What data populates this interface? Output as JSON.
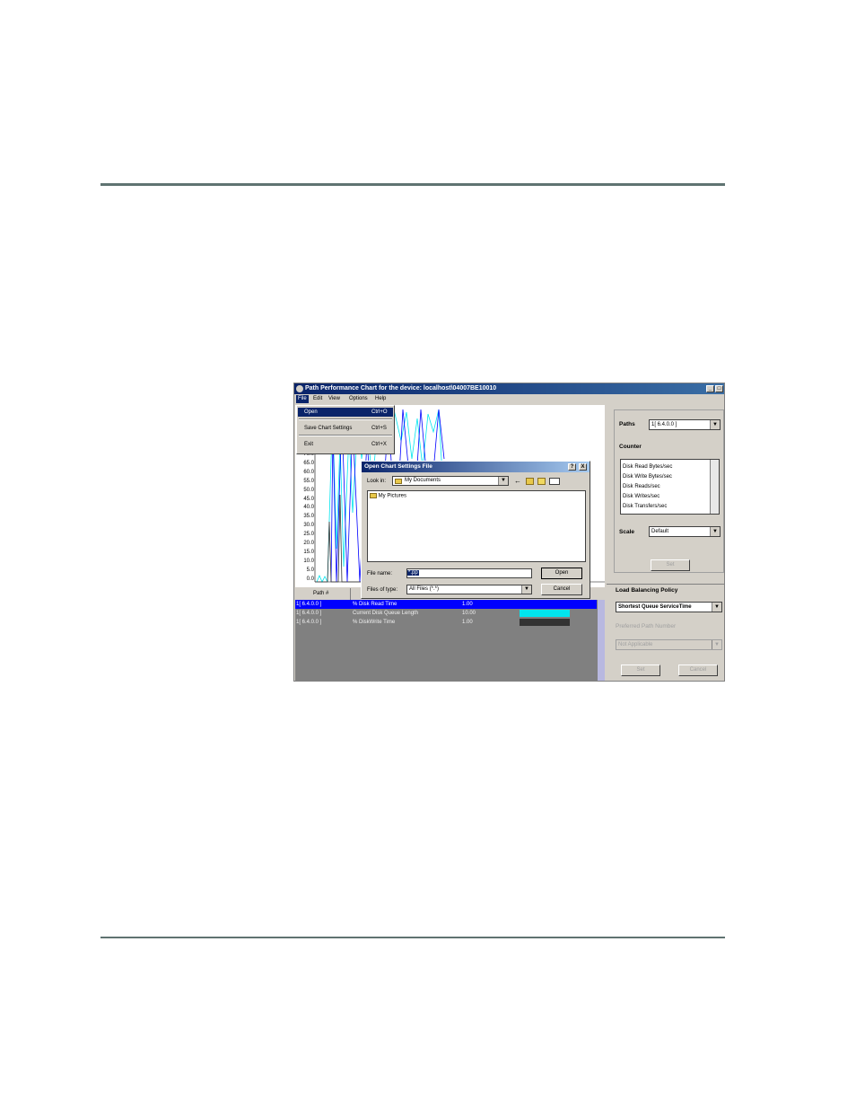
{
  "window": {
    "title": "Path Performance Chart for the device: localhost\\04007BE10010",
    "controls": [
      "_",
      "□"
    ],
    "menu": [
      "File",
      "Edit",
      "View",
      "Options",
      "Help"
    ]
  },
  "file_menu": {
    "items": [
      {
        "label": "Open",
        "shortcut": "Ctrl+O",
        "selected": true
      },
      {
        "label": "Save Chart Settings",
        "shortcut": "Ctrl+S",
        "selected": false
      },
      {
        "label": "Exit",
        "shortcut": "Ctrl+X",
        "selected": false
      }
    ]
  },
  "chart": {
    "y_ticks": [
      "70.0",
      "65.0",
      "60.0",
      "55.0",
      "50.0",
      "45.0",
      "40.0",
      "35.0",
      "30.0",
      "25.0",
      "20.0",
      "15.0",
      "10.0",
      "5.0",
      "0.0"
    ],
    "colors": {
      "series1": "#0000ff",
      "series2": "#00e5ee",
      "series3": "#333333"
    }
  },
  "right_panel": {
    "paths_label": "Paths",
    "paths_value": "1[ 6.4.0.0 ]",
    "counter_label": "Counter",
    "counters": [
      "Disk Read Bytes/sec",
      "Disk Write Bytes/sec",
      "Disk Reads/sec",
      "Disk Writes/sec",
      "Disk Transfers/sec"
    ],
    "scale_label": "Scale",
    "scale_value": "Default",
    "set_label": "Set",
    "lb_label": "Load Balancing Policy",
    "lb_value": "Shortest Queue ServiceTime",
    "pref_label": "Preferred Path Number",
    "pref_value": "Not Applicable",
    "set2_label": "Set",
    "cancel_label": "Cancel"
  },
  "grid": {
    "header": "Path #",
    "rows": [
      {
        "path": "1[ 6.4.0.0 ]",
        "counter": "% Disk Read Time",
        "scale": "1.00",
        "color": "#0000ff"
      },
      {
        "path": "1[ 6.4.0.0 ]",
        "counter": "Current Disk Queue Length",
        "scale": "10.00",
        "color": "#00e5ee"
      },
      {
        "path": "1[ 6.4.0.0 ]",
        "counter": "% DiskWrite Time",
        "scale": "1.00",
        "color": "#333333"
      }
    ]
  },
  "dialog": {
    "title": "Open Chart Settings File",
    "help": "?",
    "close": "X",
    "look_in_label": "Look in:",
    "look_in_value": "My Documents",
    "files": [
      "My Pictures"
    ],
    "file_name_label": "File name:",
    "file_name_value": "*.pp",
    "file_type_label": "Files of type:",
    "file_type_value": "All Files (*.*)",
    "open_label": "Open",
    "cancel_label": "Cancel"
  }
}
